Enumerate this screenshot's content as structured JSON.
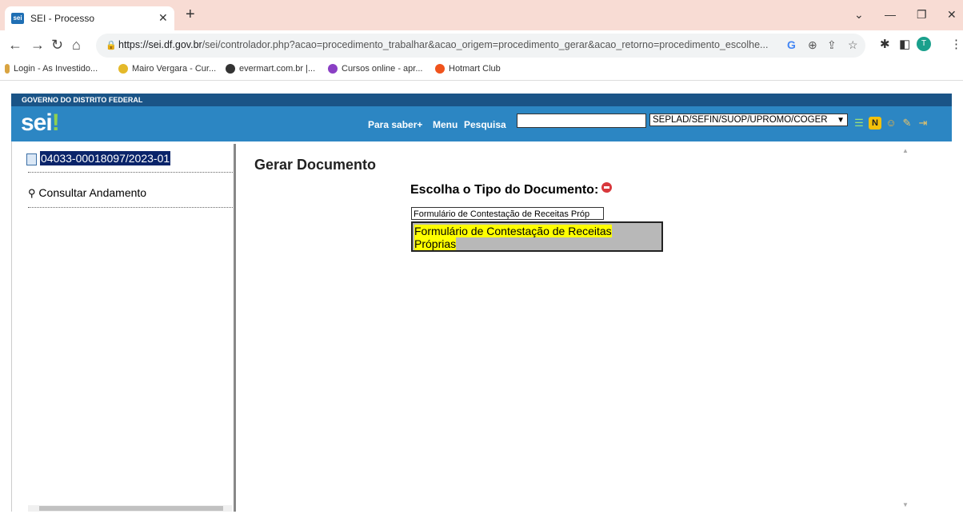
{
  "browser": {
    "tab_title": "SEI - Processo",
    "tab_favicon_text": "sei",
    "url_host": "https://sei.df.gov.br",
    "url_path": "/sei/controlador.php?acao=procedimento_trabalhar&acao_origem=procedimento_gerar&acao_retorno=procedimento_escolhe...",
    "bookmarks": [
      "Login - As Investido...",
      "Mairo Vergara - Cur...",
      "evermart.com.br |...",
      "Cursos online - apr...",
      "Hotmart Club"
    ],
    "avatar_letter": "T"
  },
  "sei": {
    "gov_label": "GOVERNO DO DISTRITO FEDERAL",
    "logo": "sei",
    "logo_mark": "!",
    "links": {
      "para_saber": "Para saber+",
      "menu": "Menu",
      "pesquisa": "Pesquisa"
    },
    "search_value": "",
    "unit": "SEPLAD/SEFIN/SUOP/UPROMO/COGER"
  },
  "left": {
    "process_number": "04033-00018097/2023-01",
    "consultar": "Consultar Andamento"
  },
  "main": {
    "title": "Gerar Documento",
    "question": "Escolha o Tipo do Documento:",
    "filter_value": "Formulário de Contestação de Receitas Próp",
    "result": "Formulário de Contestação de Receitas Próprias"
  }
}
